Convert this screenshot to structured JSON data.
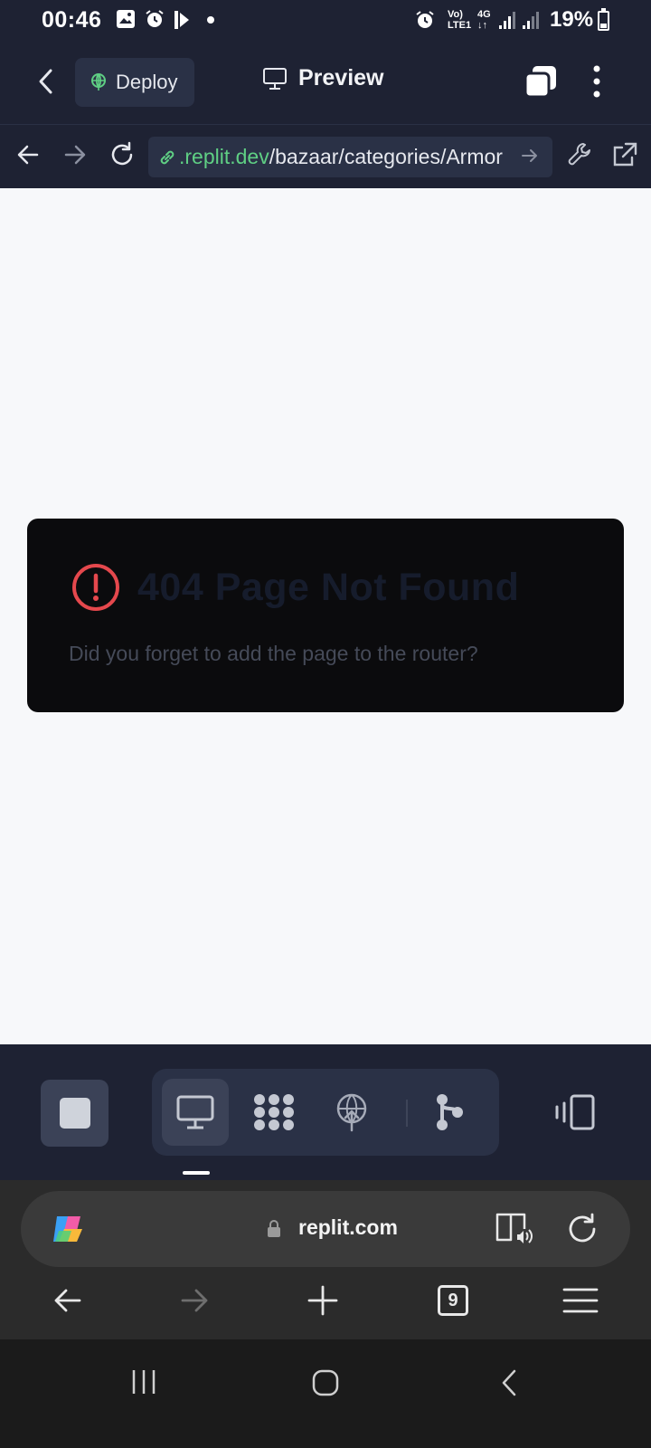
{
  "status_bar": {
    "time": "00:46",
    "volte": "Vo)\nLTE1",
    "network": "4G",
    "battery": "19%"
  },
  "topbar": {
    "deploy_label": "Deploy",
    "title": "Preview"
  },
  "urlbar": {
    "url_domain": ".replit.dev",
    "url_path": "/bazaar/categories/Armor"
  },
  "error_card": {
    "title": "404 Page Not Found",
    "message": "Did you forget to add the page to the router?"
  },
  "toolbar": {
    "tools": [
      "preview-icon",
      "workflow-icon",
      "deploy-icon",
      "git-icon"
    ],
    "active_tool": "preview-icon"
  },
  "browser": {
    "address": "replit.com",
    "tab_count": "9"
  },
  "colors": {
    "replit_bg": "#1e2233",
    "domain_green": "#5fcf84",
    "error_red": "#e5484d",
    "card_bg": "#0b0b0d"
  }
}
